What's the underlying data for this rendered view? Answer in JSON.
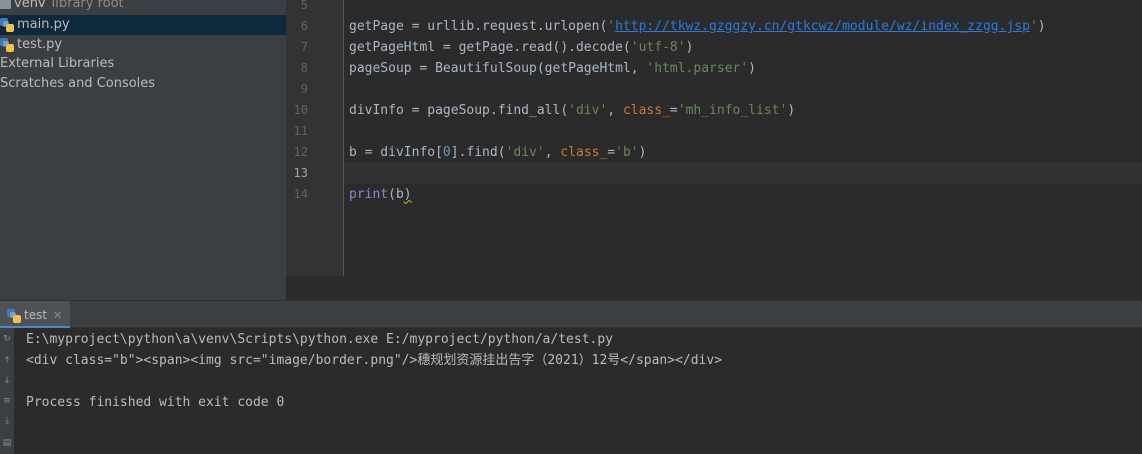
{
  "project_tree": [
    {
      "label": "venv",
      "suffix": "library root"
    },
    {
      "label": "main.py"
    },
    {
      "label": "test.py"
    },
    {
      "label": "External Libraries"
    },
    {
      "label": "Scratches and Consoles"
    }
  ],
  "editor": {
    "line_numbers": [
      "5",
      "6",
      "7",
      "8",
      "9",
      "10",
      "11",
      "12",
      "13",
      "14"
    ],
    "lines": {
      "l6": {
        "a": "getPage = urllib.request.urlopen(",
        "q1": "'",
        "url": "http://tkwz.gzggzy.cn/gtkcwz/module/wz/index_zzgg.jsp",
        "q2": "'",
        "b": ")"
      },
      "l7": {
        "a": "getPageHtml = getPage.read().decode(",
        "s": "'utf-8'",
        "b": ")"
      },
      "l8": {
        "a": "pageSoup = BeautifulSoup(getPageHtml, ",
        "s": "'html.parser'",
        "b": ")"
      },
      "l10": {
        "a": "divInfo = pageSoup.find_all(",
        "s1": "'div'",
        "c": ", ",
        "kw": "class_",
        "eq": "=",
        "s2": "'mh_info_list'",
        "b": ")"
      },
      "l12": {
        "a": "b = divInfo[",
        "n": "0",
        "m": "].find(",
        "s1": "'div'",
        "c": ", ",
        "kw": "class_",
        "eq": "=",
        "s2": "'b'",
        "b": ")"
      },
      "l14": {
        "fn": "print",
        "a": "(b",
        "b": ")"
      }
    }
  },
  "run_panel": {
    "tab_label": "test",
    "output": [
      "E:\\myproject\\python\\a\\venv\\Scripts\\python.exe E:/myproject/python/a/test.py",
      "<div class=\"b\"><span><img src=\"image/border.png\"/>穗规划资源挂出告字（2021）12号</span></div>",
      "",
      "Process finished with exit code 0"
    ]
  }
}
